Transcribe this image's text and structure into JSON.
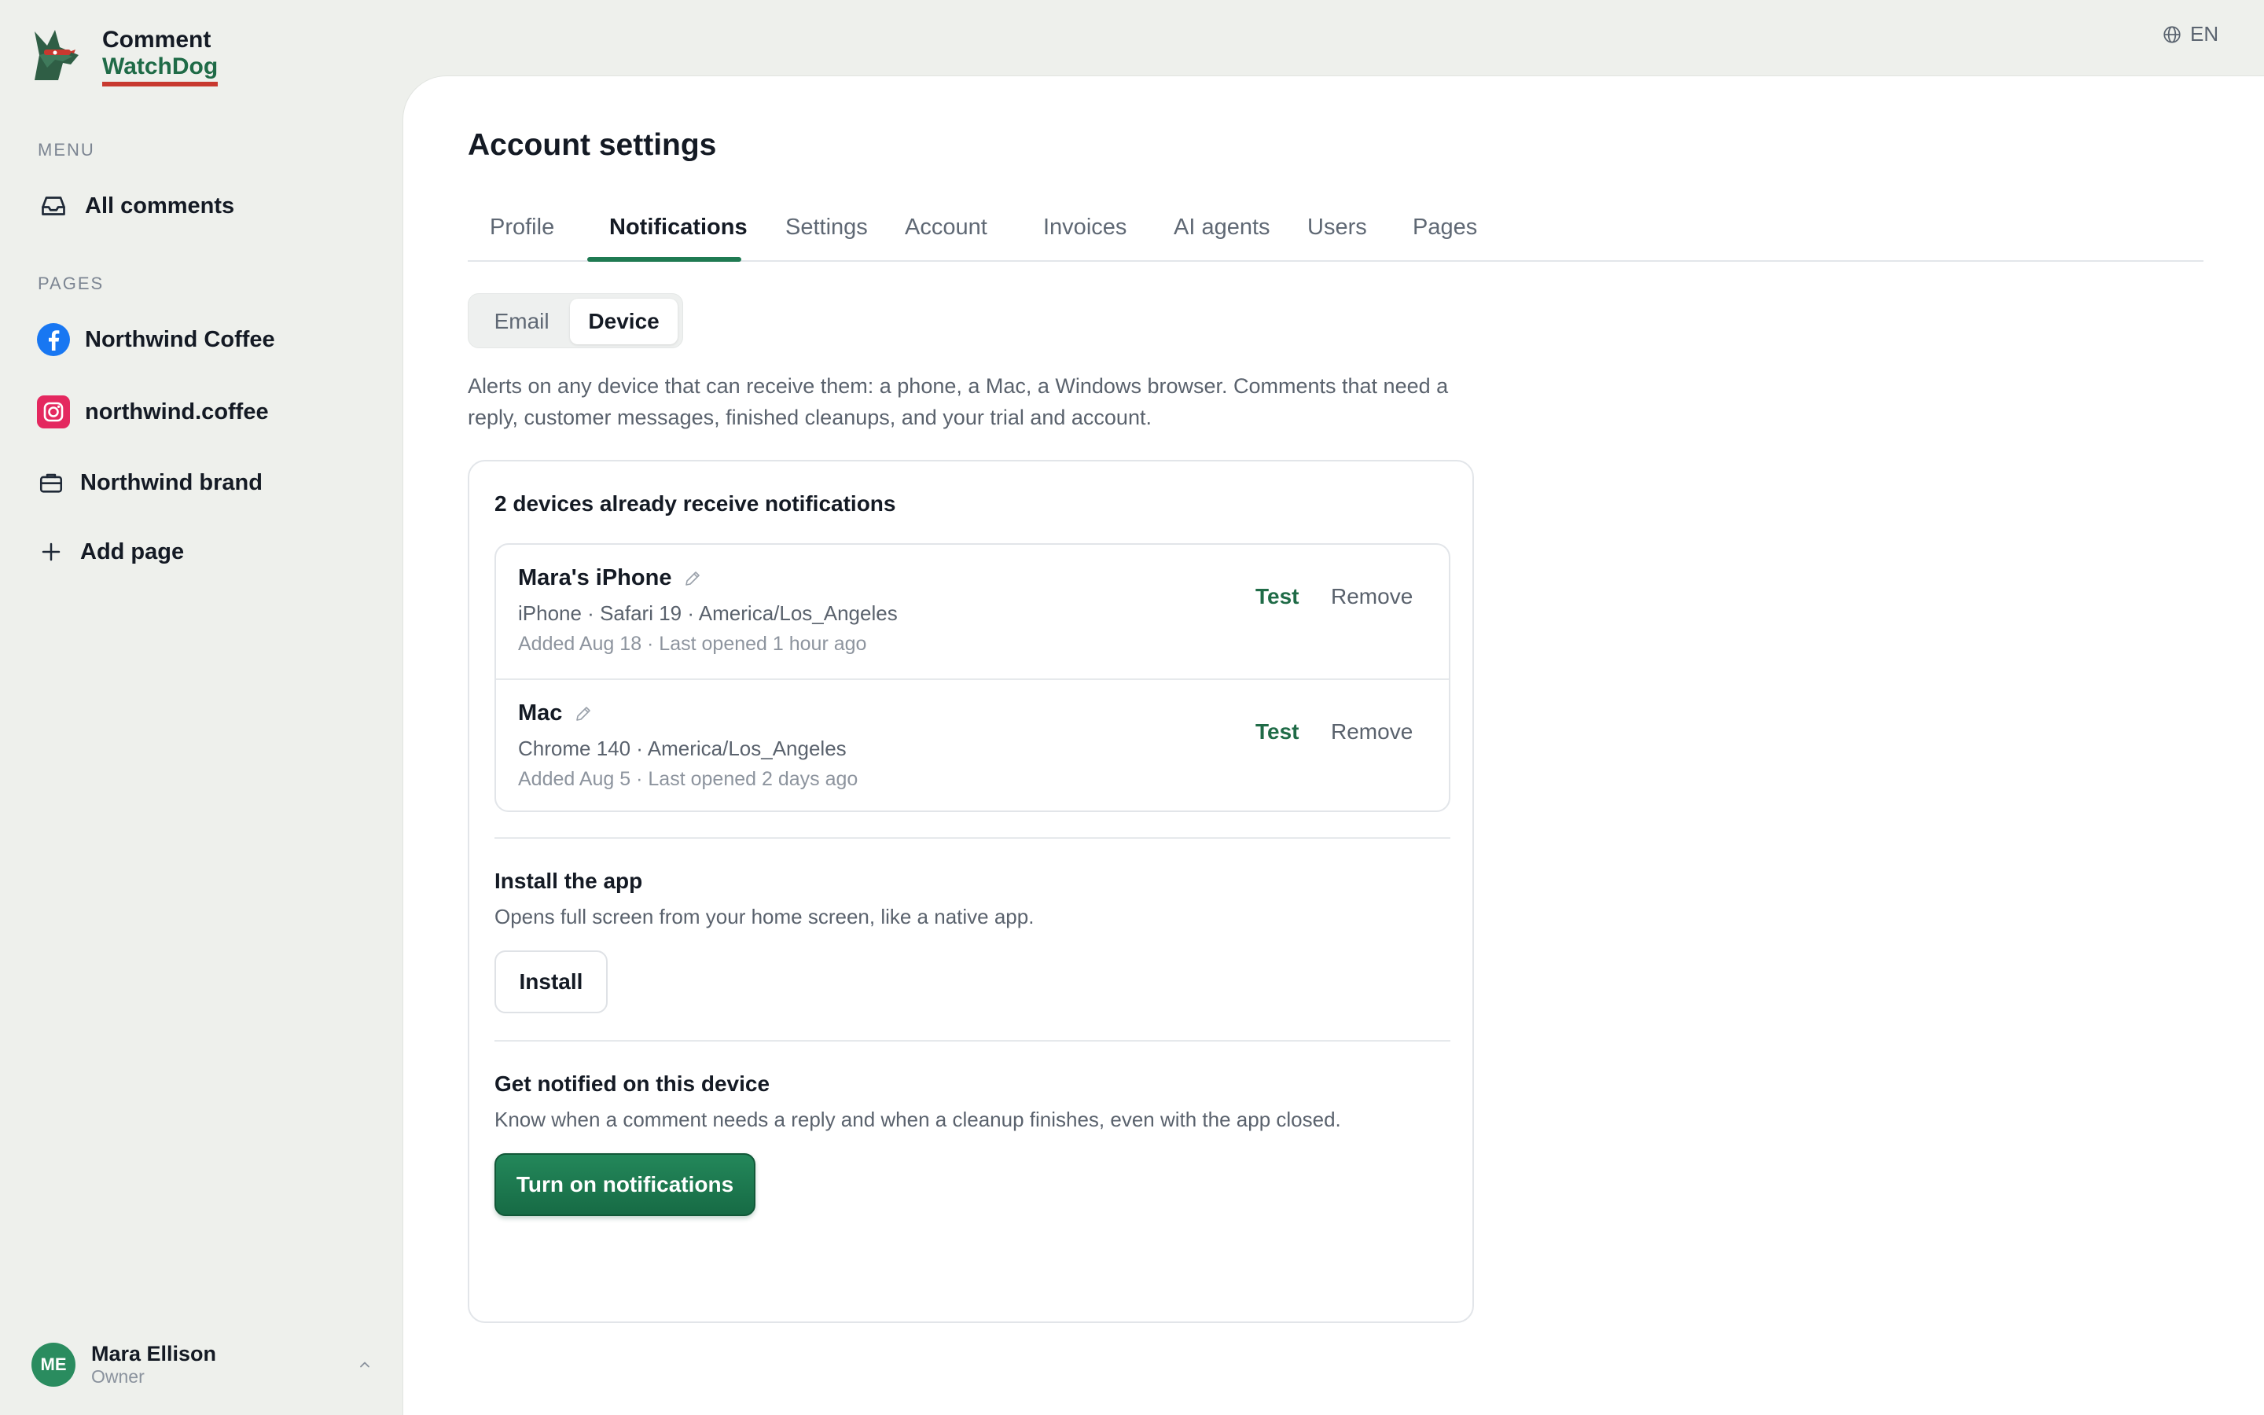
{
  "app": {
    "name_line1": "Comment",
    "name_line2": "WatchDog",
    "language": "EN",
    "brand_green": "#1f6b47",
    "brand_red": "#c8392f"
  },
  "sidebar": {
    "menu_label": "MENU",
    "menu_items": [
      {
        "label": "All comments",
        "icon": "inbox-icon"
      }
    ],
    "pages_label": "PAGES",
    "pages": [
      {
        "label": "Northwind Coffee",
        "icon": "facebook-icon"
      },
      {
        "label": "northwind.coffee",
        "icon": "instagram-icon"
      },
      {
        "label": "Northwind brand",
        "icon": "briefcase-icon"
      }
    ],
    "add_page_label": "Add page"
  },
  "user": {
    "initials": "ME",
    "name": "Mara Ellison",
    "role": "Owner"
  },
  "main": {
    "title": "Account settings",
    "tabs": [
      {
        "label": "Profile"
      },
      {
        "label": "Notifications",
        "active": true
      },
      {
        "label": "Settings"
      },
      {
        "label": "Account"
      },
      {
        "label": "Invoices"
      },
      {
        "label": "AI agents"
      },
      {
        "label": "Users"
      },
      {
        "label": "Pages"
      }
    ],
    "subtabs": [
      {
        "label": "Email"
      },
      {
        "label": "Device",
        "active": true
      }
    ],
    "description": "Alerts on any device that can receive them: a phone, a Mac, a Windows browser. Comments that need a reply, customer messages, finished cleanups, and your trial and account."
  },
  "devices_card": {
    "title": "2 devices already receive notifications",
    "devices": [
      {
        "name": "Mara's iPhone",
        "meta": "iPhone · Safari 19 · America/Los_Angeles",
        "added": "Added Aug 18 · Last opened 1 hour ago",
        "test_label": "Test",
        "remove_label": "Remove"
      },
      {
        "name": "Mac",
        "meta": "Chrome 140 · America/Los_Angeles",
        "added": "Added Aug 5 · Last opened 2 days ago",
        "test_label": "Test",
        "remove_label": "Remove"
      }
    ],
    "install": {
      "title": "Install the app",
      "text": "Opens full screen from your home screen, like a native app.",
      "button": "Install"
    },
    "notify": {
      "title": "Get notified on this device",
      "text": "Know when a comment needs a reply and when a cleanup finishes, even with the app closed.",
      "button": "Turn on notifications"
    }
  }
}
